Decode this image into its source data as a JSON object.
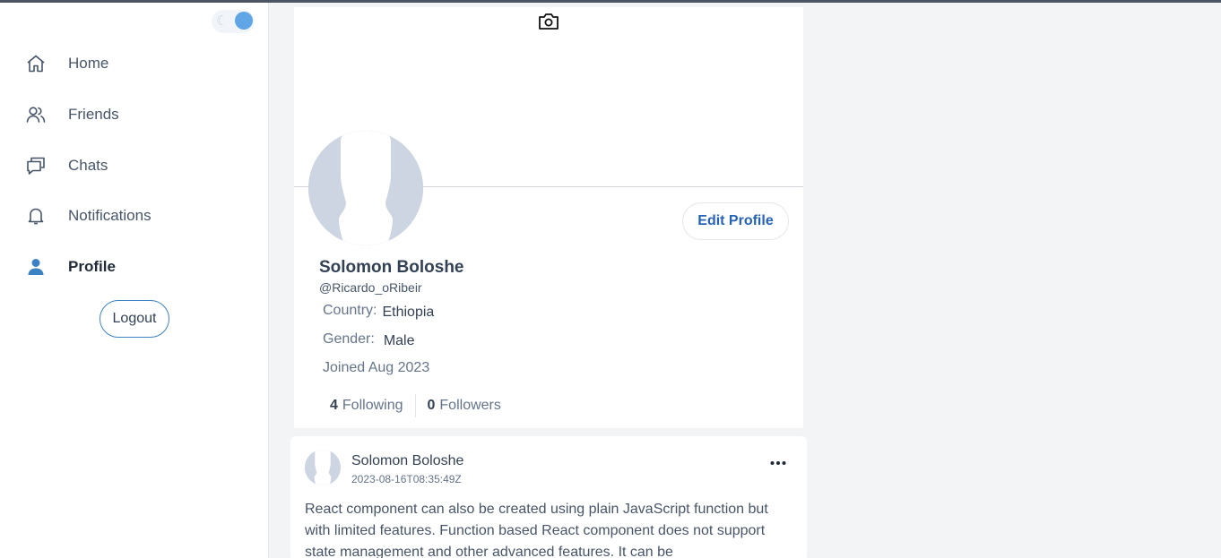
{
  "sidebar": {
    "items": [
      {
        "label": "Home",
        "icon": "home-icon"
      },
      {
        "label": "Friends",
        "icon": "users-icon"
      },
      {
        "label": "Chats",
        "icon": "chat-icon"
      },
      {
        "label": "Notifications",
        "icon": "bell-icon"
      },
      {
        "label": "Profile",
        "icon": "user-icon",
        "active": true
      }
    ],
    "logout_label": "Logout",
    "theme_toggle": {
      "icon": "moon-icon",
      "state": "light"
    }
  },
  "profile": {
    "name": "Solomon Boloshe",
    "handle": "@Ricardo_oRibeir",
    "edit_label": "Edit Profile",
    "country_label": "Country:",
    "country": "Ethiopia",
    "gender_label": "Gender:",
    "gender": "Male",
    "joined": "Joined Aug 2023",
    "following_count": "4",
    "following_label": "Following",
    "followers_count": "0",
    "followers_label": "Followers"
  },
  "post": {
    "author": "Solomon Boloshe",
    "timestamp": "2023-08-16T08:35:49Z",
    "body": "React component can also be created using plain JavaScript function but with limited features. Function based React component does not support state management and other advanced features. It can be"
  },
  "colors": {
    "accent": "#2563b8",
    "toggle_knob": "#60a5e6",
    "avatar_placeholder": "#cdd4e2"
  }
}
